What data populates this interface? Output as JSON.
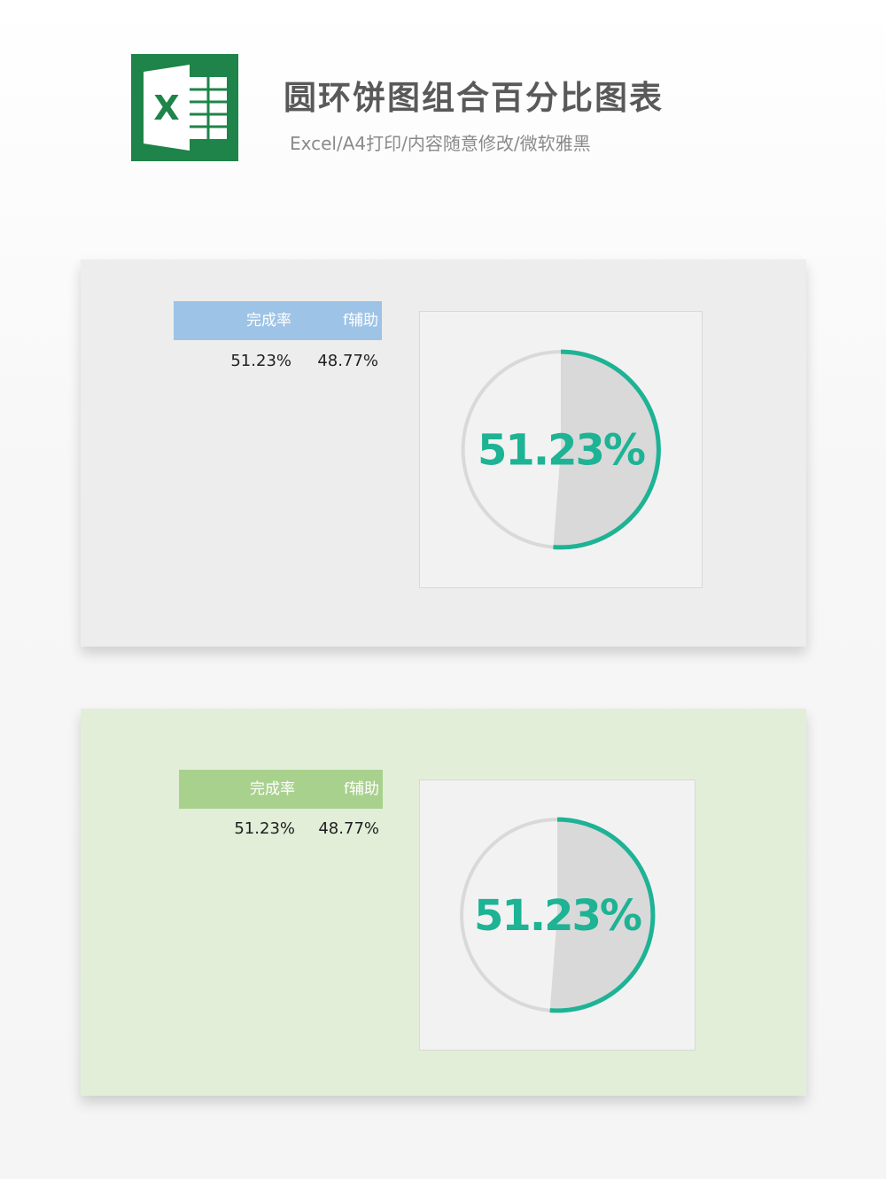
{
  "header": {
    "title": "圆环饼图组合百分比图表",
    "subtitle": "Excel/A4打印/内容随意修改/微软雅黑",
    "logo_letter": "X",
    "logo_color": "#1e8449"
  },
  "panels": [
    {
      "background": "#ededed",
      "table": {
        "header_color": "#9dc3e6",
        "columns": [
          "完成率",
          "f辅助"
        ],
        "values": [
          "51.23%",
          "48.77%"
        ]
      }
    },
    {
      "background": "#e3eed9",
      "table": {
        "header_color": "#a9d18e",
        "columns": [
          "完成率",
          "f辅助"
        ],
        "values": [
          "51.23%",
          "48.77%"
        ]
      }
    }
  ],
  "chart_data": [
    {
      "type": "pie",
      "categories": [
        "完成率",
        "f辅助"
      ],
      "values": [
        51.23,
        48.77
      ],
      "center_label": "51.23%",
      "colors": {
        "ring": "#1db394",
        "fill": "#d9d9d9",
        "track": "#d9d9d9",
        "text": "#1db394"
      }
    },
    {
      "type": "pie",
      "categories": [
        "完成率",
        "f辅助"
      ],
      "values": [
        51.23,
        48.77
      ],
      "center_label": "51.23%",
      "colors": {
        "ring": "#1db394",
        "fill": "#d9d9d9",
        "track": "#d9d9d9",
        "text": "#1db394"
      }
    }
  ]
}
